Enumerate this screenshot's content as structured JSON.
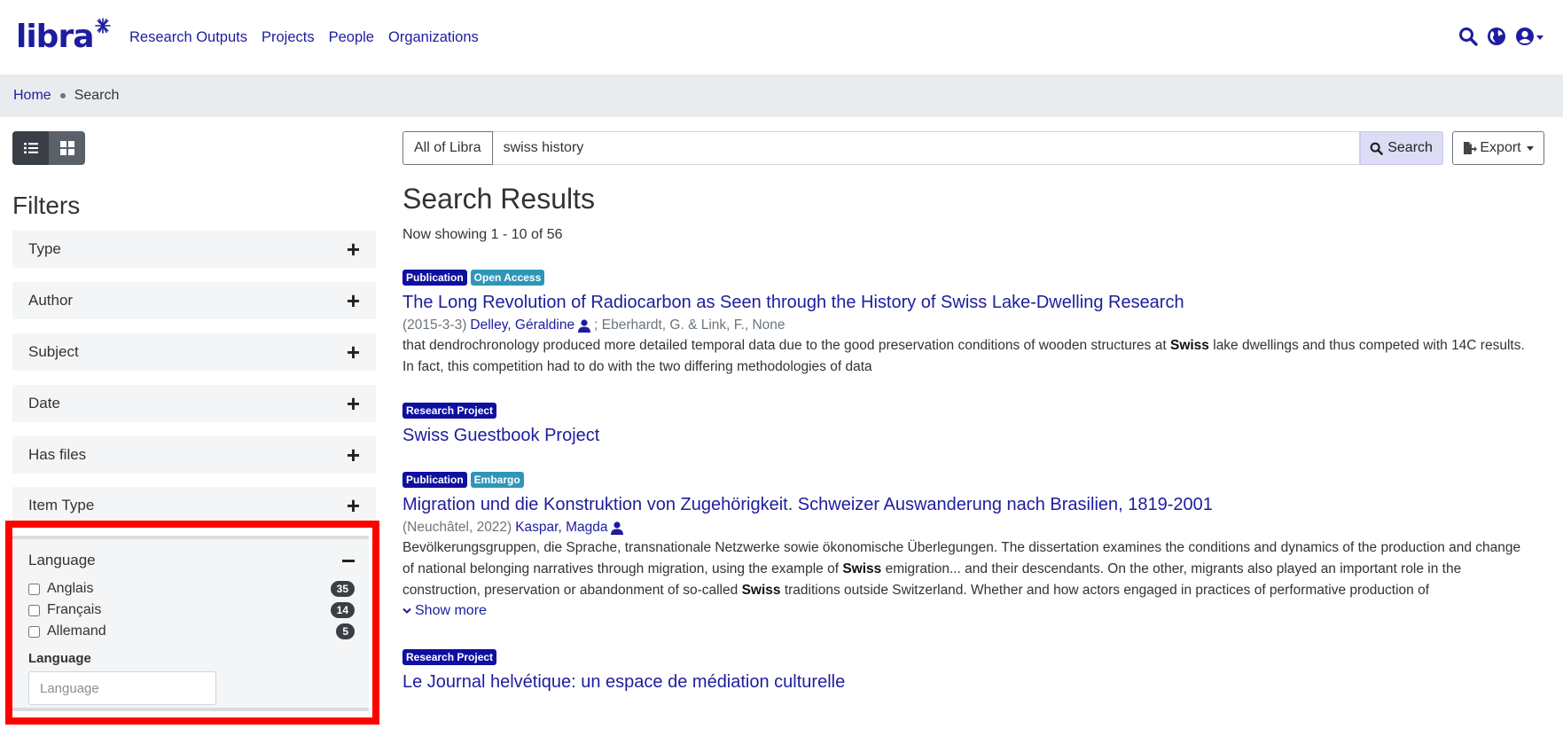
{
  "brand": {
    "logo_text": "libra",
    "accent": "#1d1d9e"
  },
  "nav": {
    "links": [
      "Research Outputs",
      "Projects",
      "People",
      "Organizations"
    ],
    "icons": [
      "search-icon",
      "globe-icon",
      "user-icon"
    ]
  },
  "breadcrumb": {
    "home": "Home",
    "current": "Search"
  },
  "filters": {
    "title": "Filters",
    "facets": [
      "Type",
      "Author",
      "Subject",
      "Date",
      "Has files",
      "Item Type"
    ],
    "language": {
      "title": "Language",
      "options": [
        {
          "label": "Anglais",
          "count": "35",
          "checked": false
        },
        {
          "label": "Français",
          "count": "14",
          "checked": false
        },
        {
          "label": "Allemand",
          "count": "5",
          "checked": false
        }
      ],
      "sub_label": "Language",
      "input_placeholder": "Language",
      "highlight_color": "#ff0000"
    }
  },
  "search": {
    "scope": "All of Libra",
    "query": "swiss history",
    "button": "Search",
    "export": "Export"
  },
  "results": {
    "title": "Search Results",
    "showing": "Now showing 1 - 10 of 56",
    "items": [
      {
        "tags": [
          "Publication",
          "Open Access"
        ],
        "title": "The Long Revolution of Radiocarbon as Seen through the History of Swiss Lake-Dwelling Research",
        "meta_prefix": "(2015-3-3)",
        "author": "Delley, Géraldine",
        "meta_suffix": "; Eberhardt, G. & Link, F., None",
        "abstract_1": "that dendrochronology produced more detailed temporal data due to the good preservation conditions of wooden structures at ",
        "abstract_bold": "Swiss",
        "abstract_2": " lake dwellings and thus competed with 14C results. In fact, this competition had to do with the two differing methodologies of data"
      },
      {
        "tags": [
          "Research Project"
        ],
        "title": "Swiss Guestbook Project"
      },
      {
        "tags": [
          "Publication",
          "Embargo"
        ],
        "title": "Migration und die Konstruktion von Zugehörigkeit. Schweizer Auswanderung nach Brasilien, 1819-2001",
        "meta_prefix": "(Neuchâtel, 2022)",
        "author": "Kaspar, Magda",
        "abstract_1": "Bevölkerungsgruppen, die Sprache, transnationale Netzwerke sowie ökonomische Überlegungen. The dissertation examines the conditions and dynamics of the production and change of national belonging narratives through migration, using the example of ",
        "abstract_bold": "Swiss",
        "abstract_2": " emigration... and their descendants. On the other, migrants also played an important role in the construction, preservation or abandonment of so-called ",
        "abstract_bold_2": "Swiss",
        "abstract_3": " traditions outside Switzerland. Whether and how actors engaged in practices of performative production of",
        "show_more": "Show more"
      },
      {
        "tags": [
          "Research Project"
        ],
        "title": "Le Journal helvétique: un espace de médiation culturelle"
      }
    ]
  }
}
